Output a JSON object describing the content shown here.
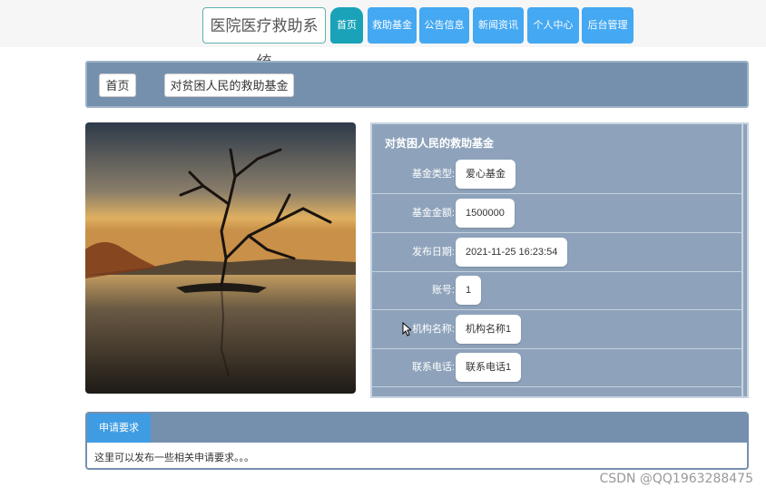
{
  "header": {
    "site_title": "医院医疗救助系统",
    "nav": [
      {
        "label": "首页"
      },
      {
        "label": "救助基金"
      },
      {
        "label": "公告信息"
      },
      {
        "label": "新闻资讯"
      },
      {
        "label": "个人中心"
      },
      {
        "label": "后台管理"
      }
    ],
    "active_nav": "首页"
  },
  "breadcrumb": {
    "home": "首页",
    "current": "对贫困人民的救助基金"
  },
  "detail": {
    "title": "对贫困人民的救助基金",
    "fields": [
      {
        "label": "基金类型:",
        "value": "爱心基金"
      },
      {
        "label": "基金金额:",
        "value": "1500000"
      },
      {
        "label": "发布日期:",
        "value": "2021-11-25 16:23:54"
      },
      {
        "label": "账号:",
        "value": "1"
      },
      {
        "label": "机构名称:",
        "value": "机构名称1"
      },
      {
        "label": "联系电话:",
        "value": "联系电话1"
      }
    ]
  },
  "requirements": {
    "tab_label": "申请要求",
    "content": "这里可以发布一些相关申请要求。。。"
  },
  "watermark": "CSDN @QQ1963288475",
  "colors": {
    "nav_blue": "#44a8f2",
    "nav_active": "#1aa3b8",
    "panel_slate": "#7590ad"
  }
}
